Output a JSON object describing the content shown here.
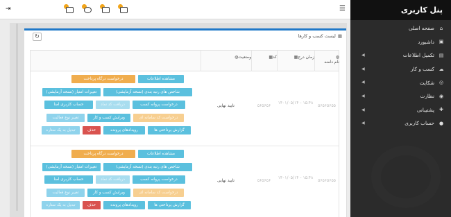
{
  "topbar": {
    "menu_glyph": "☰",
    "exit_glyph": "⇥",
    "icons": [
      "mail-notification-icon",
      "plus-notification-icon",
      "inbox-notification-icon",
      "calendar-notification-icon"
    ]
  },
  "sidebar": {
    "title": "پنل کاربری",
    "items": [
      {
        "label": "صفحه اصلی",
        "icon": "home-icon",
        "glyph": "⌂",
        "has_sub": false
      },
      {
        "label": "داشبورد",
        "icon": "dashboard-icon",
        "glyph": "▣",
        "has_sub": false
      },
      {
        "label": "تکمیل اطلاعات",
        "icon": "id-card-icon",
        "glyph": "▤",
        "has_sub": true
      },
      {
        "label": "کسب و کار",
        "icon": "cloud-icon",
        "glyph": "☁",
        "has_sub": true
      },
      {
        "label": "شکایت",
        "icon": "support-icon",
        "glyph": "◎",
        "has_sub": true
      },
      {
        "label": "نظارت",
        "icon": "eye-icon",
        "glyph": "◉",
        "has_sub": true
      },
      {
        "label": "پشتیبانی",
        "icon": "lifebuoy-icon",
        "glyph": "✚",
        "has_sub": true
      },
      {
        "label": "حساب کاربری",
        "icon": "user-icon",
        "glyph": "●",
        "has_sub": true
      }
    ]
  },
  "card": {
    "title": "لیست کسب و کارها",
    "refresh_glyph": "↻"
  },
  "table": {
    "headers": {
      "name": "نام دامنه",
      "date": "زمان درج",
      "code": "کد",
      "status": "وضعیت"
    },
    "rows": [
      {
        "name": "۵۶۵۶۵۶۵۵",
        "date": "۱۴۰۱/۰۵/۱۴ - ۱۵:۴۸",
        "code": "۵۶۵۶۵۶",
        "status": "تایید نهایی"
      },
      {
        "name": "۵۶۵۶۵۶۵۵",
        "date": "۱۴۰۱/۰۵/۱۴ - ۱۵:۴۸",
        "code": "۵۶۵۶۵۶",
        "status": "تایید نهایی"
      }
    ]
  },
  "actions": {
    "view": "مشاهده اطلاعات",
    "payment_request": "درخواست درگاه پرداخت",
    "rank_index": "شاخص های رتبه بندی (نسخه آزمایشی)",
    "score_changes": "تغییرات امتیاز (نسخه آزمایشی)",
    "license_request": "درخواست پروانه کسب",
    "receive_symbol": "دریافت کد نماد",
    "user_account": "حساب کاربری امنا",
    "shaparak_request": "درخواست کد سامانه ای",
    "edit_business": "ویرایش کسب و کار",
    "change_activity": "تغییر نوع فعالیت",
    "payment_report": "گزارش پرداختی ها",
    "file_events": "رویدادهای پرونده",
    "delete": "حذف",
    "convert": "تبدیل به یک ستاره"
  }
}
